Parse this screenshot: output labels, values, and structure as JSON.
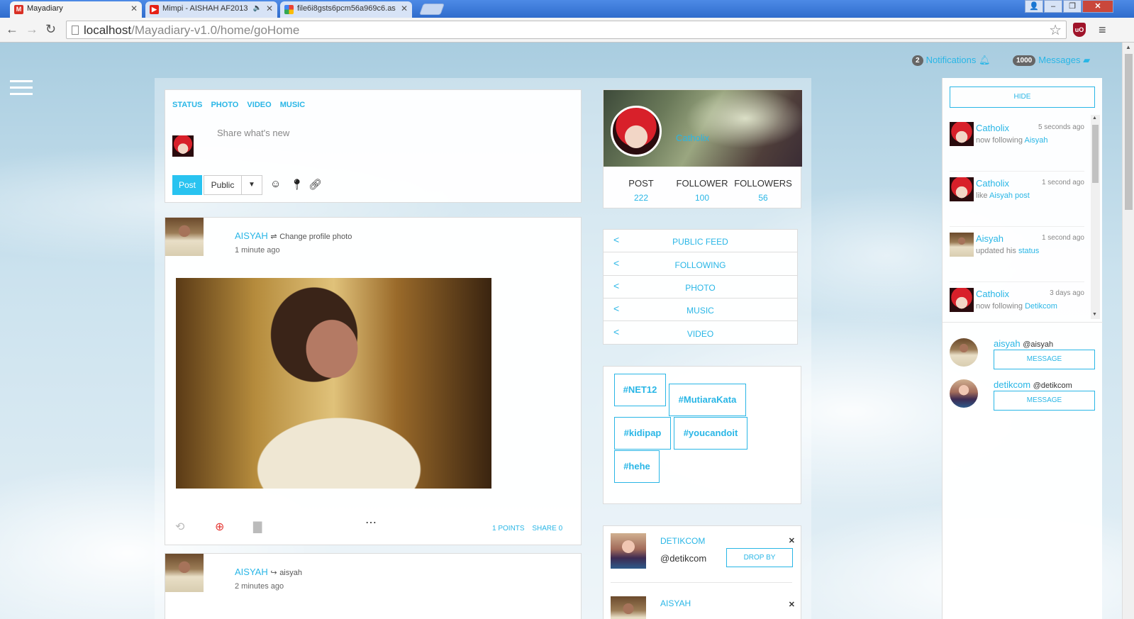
{
  "browser": {
    "tabs": [
      {
        "title": "Mayadiary",
        "active": true,
        "favicon": "gmail-icon",
        "color": "#d93025"
      },
      {
        "title": "Mimpi - AISHAH AF2013",
        "active": false,
        "favicon": "youtube-icon",
        "color": "#e62117",
        "audio": "speaker-icon"
      },
      {
        "title": "file6i8gsts6pcm56a969c6.as",
        "active": false,
        "favicon": "picasa-icon",
        "color": "#4285f4"
      }
    ],
    "url_host": "localhost",
    "url_path": "/Mayadiary-v1.0/home/goHome",
    "ublock_label": "uO"
  },
  "topbar": {
    "notifications_count": "2",
    "notifications_label": "Notifications",
    "messages_count": "1000",
    "messages_label": "Messages"
  },
  "composer": {
    "tabs": [
      "STATUS",
      "PHOTO",
      "VIDEO",
      "MUSIC"
    ],
    "placeholder": "Share what's new",
    "post_label": "Post",
    "privacy_label": "Public"
  },
  "posts": [
    {
      "author": "AISYAH",
      "action": "Change profile photo",
      "time": "1 minute ago",
      "points": "1 POINTS",
      "share": "SHARE 0"
    },
    {
      "author": "AISYAH",
      "action": "aisyah",
      "time": "2 minutes ago"
    }
  ],
  "profile": {
    "name": "Catholix",
    "stats": [
      {
        "label": "POST",
        "value": "222"
      },
      {
        "label": "FOLLOWER",
        "value": "100"
      },
      {
        "label": "FOLLOWERS",
        "value": "56"
      }
    ]
  },
  "feed_menu": [
    "PUBLIC FEED",
    "FOLLOWING",
    "PHOTO",
    "MUSIC",
    "VIDEO"
  ],
  "tags": [
    "#NET12",
    "#MutiaraKata",
    "#kidipap",
    "#youcandoit",
    "#hehe"
  ],
  "suggestions": [
    {
      "name": "DETIKCOM",
      "handle": "@detikcom",
      "button": "DROP BY"
    },
    {
      "name": "AISYAH"
    }
  ],
  "sidebar": {
    "hide_label": "HIDE",
    "activities": [
      {
        "who": "Catholix",
        "when": "5 seconds ago",
        "text": "now following ",
        "target": "Aisyah"
      },
      {
        "who": "Catholix",
        "when": "1 second ago",
        "text": "like ",
        "target": "Aisyah post"
      },
      {
        "who": "Aisyah",
        "when": "1 second ago",
        "text": "updated his ",
        "target": "status"
      },
      {
        "who": "Catholix",
        "when": "3 days ago",
        "text": "now following ",
        "target": "Detikcom"
      }
    ],
    "contacts": [
      {
        "name": "aisyah",
        "handle": "@aisyah",
        "button": "MESSAGE"
      },
      {
        "name": "detikcom",
        "handle": "@detikcom",
        "button": "MESSAGE"
      }
    ]
  },
  "colors": {
    "accent": "#29b6e6",
    "button_fill": "#29c3f0"
  }
}
